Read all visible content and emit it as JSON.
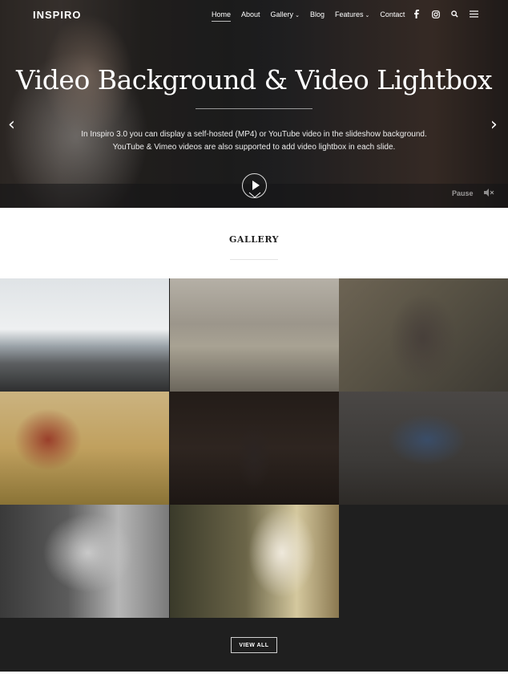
{
  "nav": {
    "logo": "INSPIRO",
    "items": [
      {
        "label": "Home",
        "active": true,
        "caret": false
      },
      {
        "label": "About",
        "active": false,
        "caret": false
      },
      {
        "label": "Gallery",
        "active": false,
        "caret": true
      },
      {
        "label": "Blog",
        "active": false,
        "caret": false
      },
      {
        "label": "Features",
        "active": false,
        "caret": true
      },
      {
        "label": "Contact",
        "active": false,
        "caret": false
      }
    ],
    "icons": [
      "facebook-icon",
      "instagram-icon",
      "search-icon",
      "menu-icon"
    ]
  },
  "hero": {
    "title": "Video Background & Video Lightbox",
    "text_line1": "In Inspiro 3.0 you can display a self-hosted (MP4) or YouTube video in the slideshow background.",
    "text_line2": "YouTube & Vimeo videos are also supported to add video lightbox in each slide.",
    "pause_label": "Pause"
  },
  "gallery": {
    "title": "GALLERY",
    "view_all_label": "VIEW ALL"
  },
  "colors": {
    "dark_bg": "#1f1f1f",
    "text_dark": "#222222",
    "white": "#ffffff"
  }
}
